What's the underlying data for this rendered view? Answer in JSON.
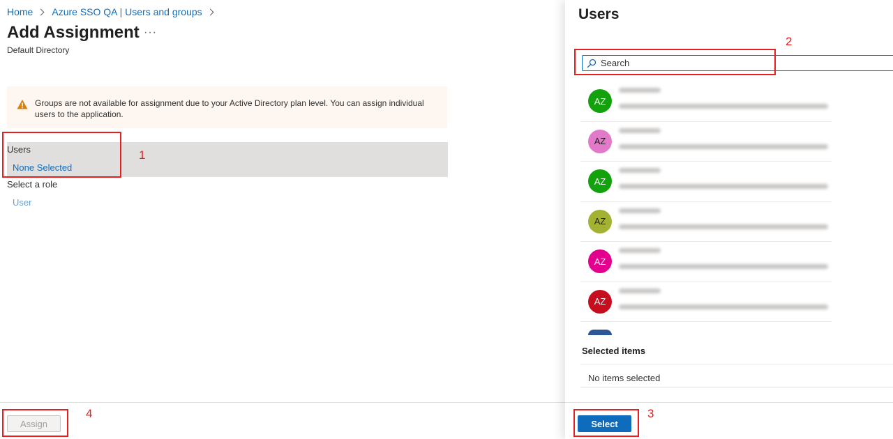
{
  "breadcrumb": {
    "items": [
      "Home",
      "Azure SSO QA | Users and groups"
    ]
  },
  "page": {
    "title": "Add Assignment",
    "more_label": "···",
    "subtitle": "Default Directory"
  },
  "warning": {
    "text": "Groups are not available for assignment due to your Active Directory plan level. You can assign individual users to the application."
  },
  "form": {
    "users_label": "Users",
    "users_value": "None Selected",
    "role_label": "Select a role",
    "role_value": "User"
  },
  "footer": {
    "assign_label": "Assign"
  },
  "panel": {
    "title": "Users",
    "search_placeholder": "Search",
    "users": [
      {
        "initials": "AZ",
        "color": "#13a10e"
      },
      {
        "initials": "AZ",
        "color": "#e37ac9"
      },
      {
        "initials": "AZ",
        "color": "#13a10e"
      },
      {
        "initials": "AZ",
        "color": "#a4b234"
      },
      {
        "initials": "AZ",
        "color": "#e3008c"
      },
      {
        "initials": "AZ",
        "color": "#c50f1f"
      }
    ],
    "selected_items_label": "Selected items",
    "no_items_label": "No items selected",
    "select_label": "Select"
  },
  "annotations": [
    "1",
    "2",
    "3",
    "4"
  ],
  "colors": {
    "accent": "#0f6cbd",
    "annotation": "#e81f1f",
    "warning_bg": "#fdf6f1",
    "row_highlight": "#e1dfdd"
  }
}
